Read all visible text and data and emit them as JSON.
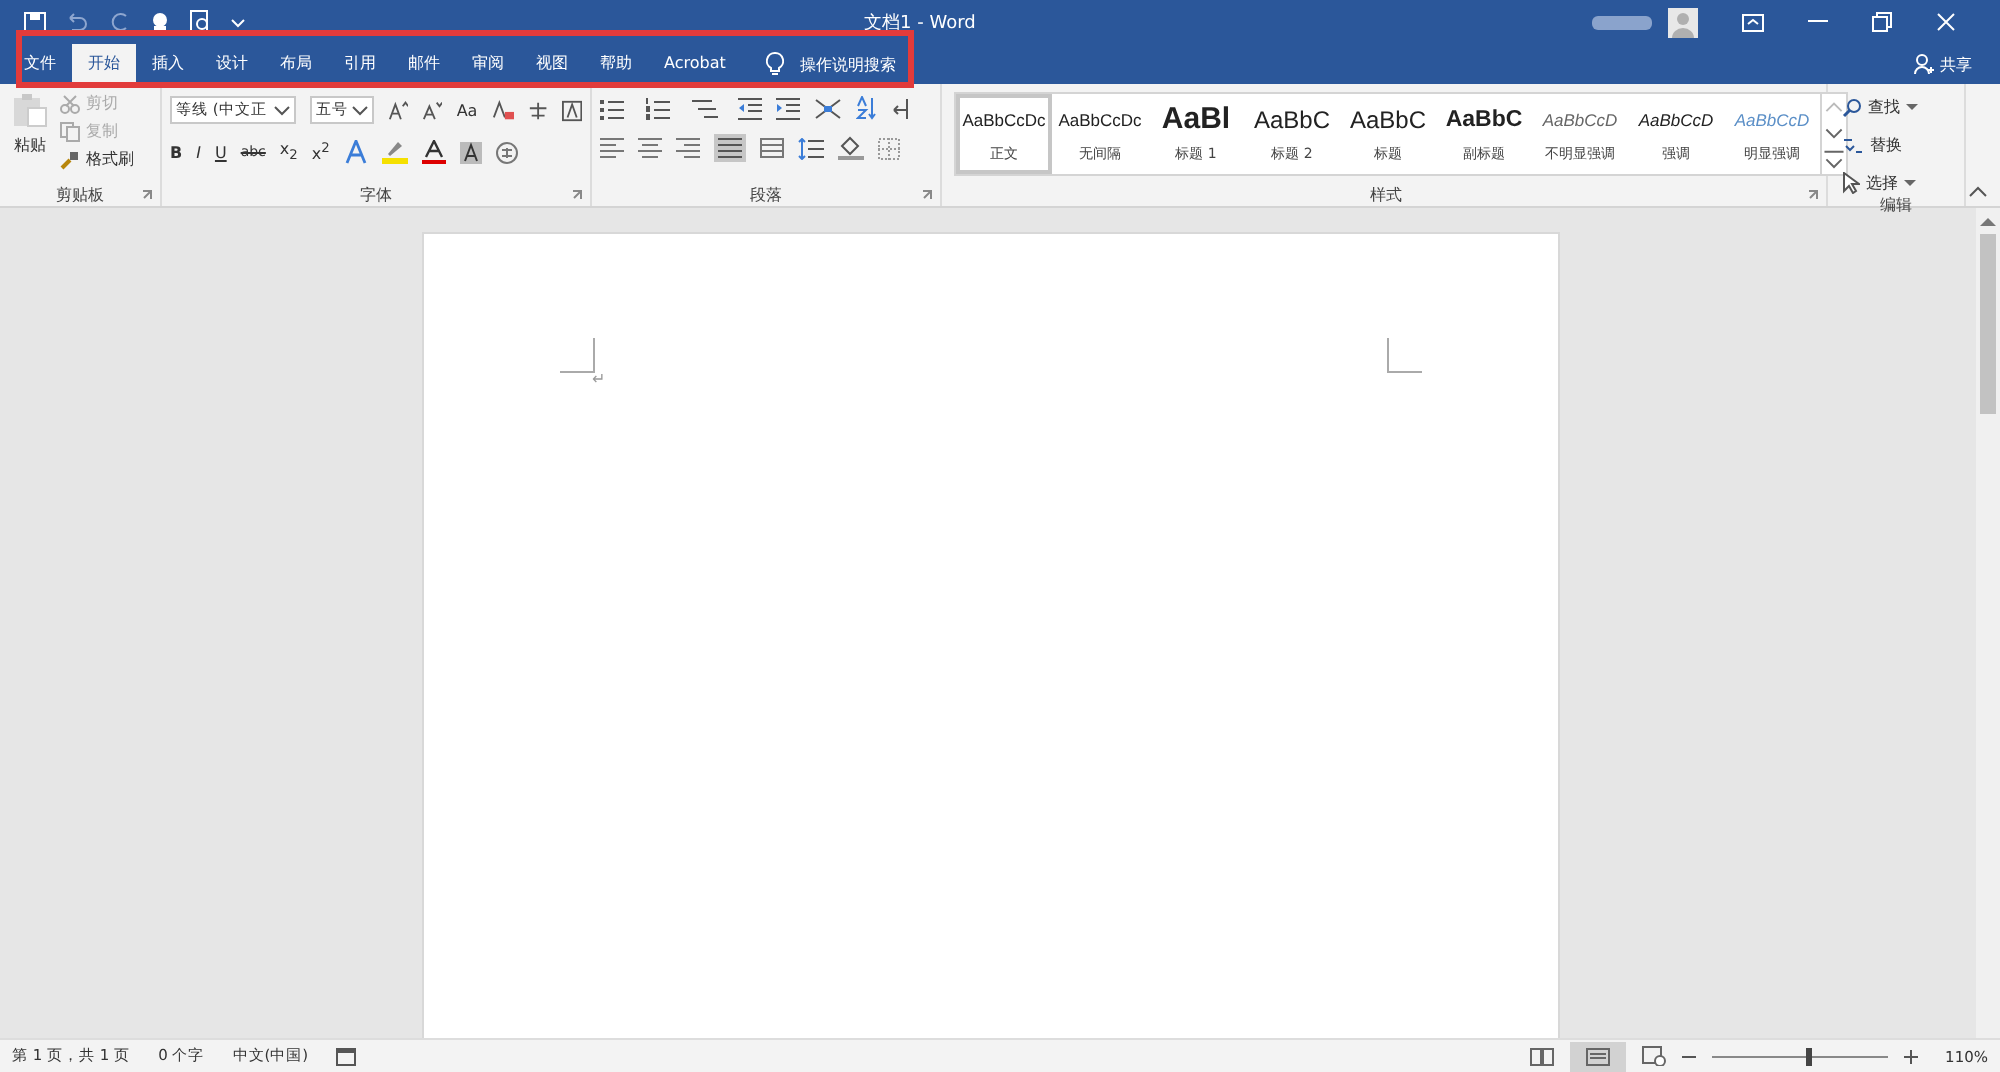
{
  "title_bar": {
    "title": "文档1 - Word"
  },
  "tabs": [
    {
      "label": "文件",
      "selected": false
    },
    {
      "label": "开始",
      "selected": true
    },
    {
      "label": "插入",
      "selected": false
    },
    {
      "label": "设计",
      "selected": false
    },
    {
      "label": "布局",
      "selected": false
    },
    {
      "label": "引用",
      "selected": false
    },
    {
      "label": "邮件",
      "selected": false
    },
    {
      "label": "审阅",
      "selected": false
    },
    {
      "label": "视图",
      "selected": false
    },
    {
      "label": "帮助",
      "selected": false
    },
    {
      "label": "Acrobat",
      "selected": false
    }
  ],
  "tell_me": {
    "placeholder": "操作说明搜索"
  },
  "share": "共享",
  "clipboard": {
    "paste": "粘贴",
    "cut": "剪切",
    "copy": "复制",
    "format_painter": "格式刷",
    "label": "剪贴板"
  },
  "font": {
    "name": "等线 (中文正",
    "size": "五号",
    "change_case": "Aa",
    "bold": "B",
    "italic": "I",
    "underline": "U",
    "strikethrough": "abc",
    "subscript": "x$_{2}$",
    "superscript": "x$^{2}$",
    "label": "字体"
  },
  "paragraph": {
    "label": "段落"
  },
  "styles": {
    "label": "样式",
    "items": [
      {
        "kind": "normal",
        "preview": "AaBbCcDc",
        "name": "正文",
        "selected": true
      },
      {
        "kind": "no_spacing",
        "preview": "AaBbCcDc",
        "name": "无间隔",
        "selected": false
      },
      {
        "kind": "heading1",
        "preview": "AaBl",
        "name": "标题 1",
        "selected": false
      },
      {
        "kind": "heading2",
        "preview": "AaBbC",
        "name": "标题 2",
        "selected": false
      },
      {
        "kind": "title",
        "preview": "AaBbC",
        "name": "标题",
        "selected": false
      },
      {
        "kind": "subtitle",
        "preview": "AaBbC",
        "name": "副标题",
        "selected": false
      },
      {
        "kind": "subtle_emphasis",
        "preview": "AaBbCcD",
        "name": "不明显强调",
        "selected": false
      },
      {
        "kind": "emphasis",
        "preview": "AaBbCcD",
        "name": "强调",
        "selected": false
      },
      {
        "kind": "intense_emphasis",
        "preview": "AaBbCcD",
        "name": "明显强调",
        "selected": false
      }
    ]
  },
  "editing": {
    "find": "查找",
    "replace": "替换",
    "select": "选择",
    "label": "编辑"
  },
  "document": {
    "paragraph_mark": "↵"
  },
  "status_bar": {
    "page": "第 1 页，共 1 页",
    "words": "0 个字",
    "language": "中文(中国)",
    "zoom": "110%",
    "zoom_slider": {
      "level": 0.55
    }
  }
}
